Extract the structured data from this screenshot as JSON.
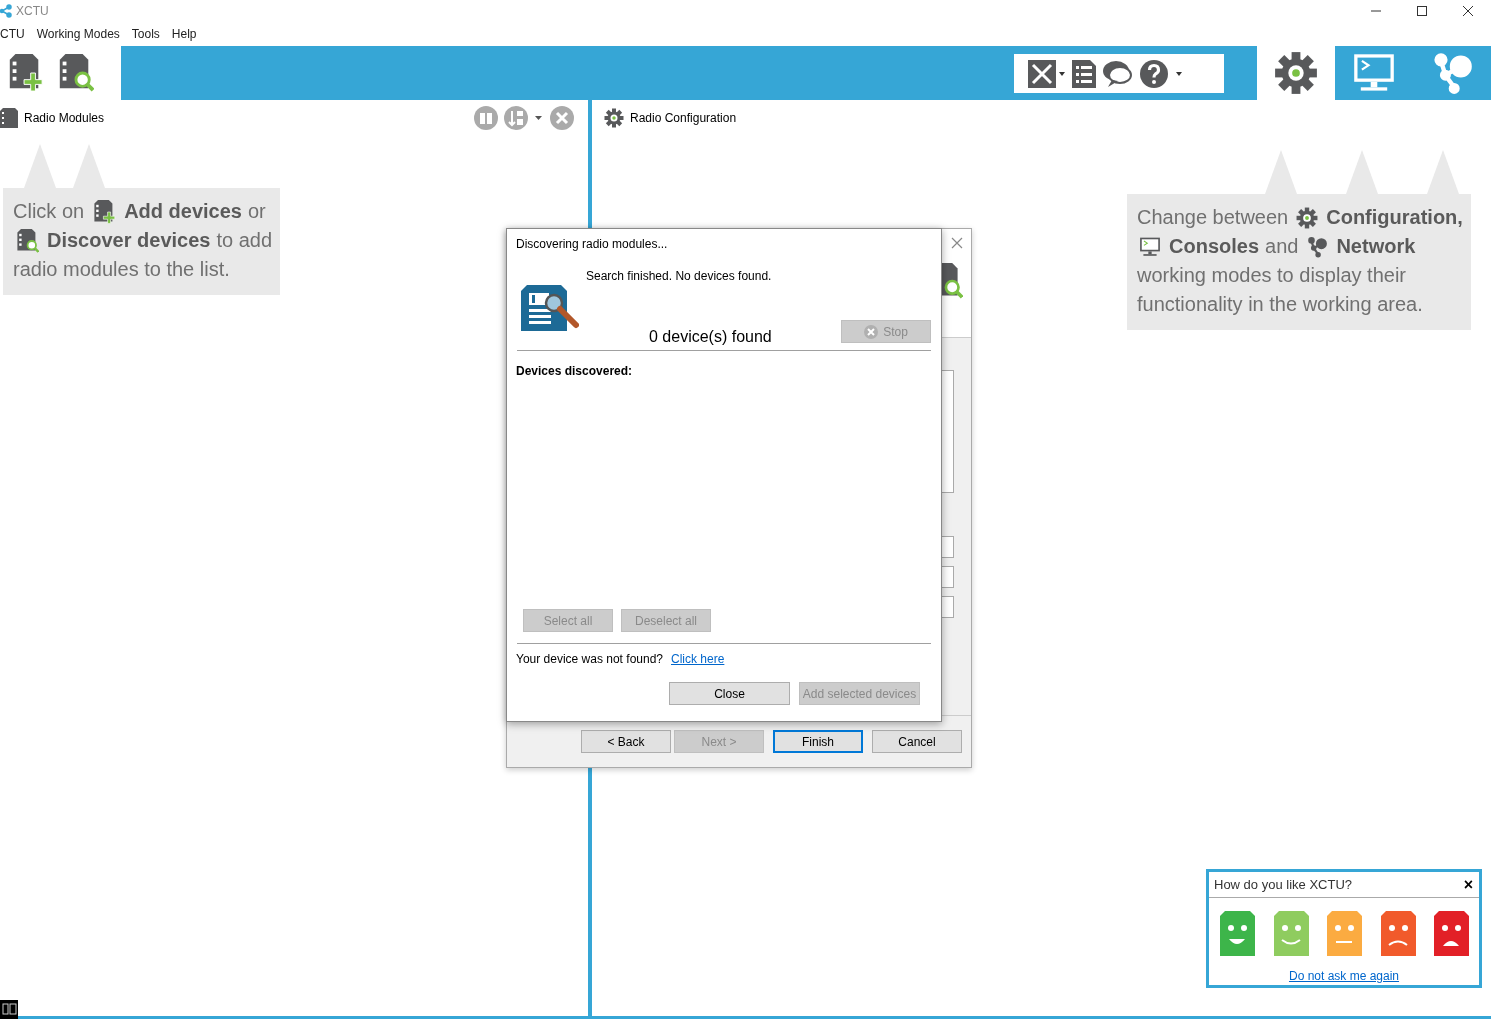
{
  "window": {
    "title": "XCTU"
  },
  "menu": [
    {
      "label": "CTU"
    },
    {
      "label": "Working Modes"
    },
    {
      "label": "Tools"
    },
    {
      "label": "Help"
    }
  ],
  "modes": [
    {
      "kind": "configuration",
      "selected": true
    },
    {
      "kind": "consoles",
      "selected": false
    },
    {
      "kind": "network",
      "selected": false
    }
  ],
  "left_panel": {
    "title": "Radio Modules",
    "hint": [
      [
        {
          "kind": "text",
          "text": "Click on"
        },
        {
          "kind": "icon"
        },
        {
          "kind": "bold",
          "text": "Add devices"
        },
        {
          "kind": "text",
          "text": "or"
        }
      ],
      [
        {
          "kind": "icon"
        },
        {
          "kind": "bold",
          "text": "Discover devices"
        },
        {
          "kind": "text",
          "text": "to add"
        }
      ],
      [
        {
          "kind": "text",
          "text": "radio modules to the list."
        }
      ]
    ]
  },
  "right_panel": {
    "title": "Radio Configuration",
    "hint": [
      [
        {
          "kind": "text",
          "text": "Change between"
        },
        {
          "kind": "icon"
        },
        {
          "kind": "bold",
          "text": "Configuration,"
        }
      ],
      [
        {
          "kind": "icon"
        },
        {
          "kind": "bold",
          "text": "Consoles"
        },
        {
          "kind": "text",
          "text": "and"
        },
        {
          "kind": "icon"
        },
        {
          "kind": "bold",
          "text": "Network"
        }
      ],
      [
        {
          "kind": "text",
          "text": "working modes to display their"
        }
      ],
      [
        {
          "kind": "text",
          "text": "functionality in the working area."
        }
      ]
    ]
  },
  "wizard": {
    "buttons": [
      {
        "label": "< Back",
        "disabled": false,
        "default": false
      },
      {
        "label": "Next >",
        "disabled": true,
        "default": false
      },
      {
        "label": "Finish",
        "disabled": false,
        "default": true
      },
      {
        "label": "Cancel",
        "disabled": false,
        "default": false
      }
    ]
  },
  "discovery_dialog": {
    "title": "Discovering radio modules...",
    "status": "Search finished. No devices found.",
    "count": "0 device(s) found",
    "stop": {
      "label": "Stop",
      "disabled": true
    },
    "list_label": "Devices discovered:",
    "list_buttons": [
      {
        "label": "Select all",
        "disabled": true
      },
      {
        "label": "Deselect all",
        "disabled": true
      }
    ],
    "not_found": "Your device was not found?",
    "link": "Click here",
    "buttons": [
      {
        "label": "Close",
        "disabled": false
      },
      {
        "label": "Add selected devices",
        "disabled": true
      }
    ]
  },
  "feedback": {
    "title": "How do you like XCTU?",
    "close": "×",
    "faces": [
      {
        "kind": "very-happy",
        "color": "#3db54a"
      },
      {
        "kind": "happy",
        "color": "#8fcc5f"
      },
      {
        "kind": "neutral",
        "color": "#fbab41"
      },
      {
        "kind": "sad",
        "color": "#f15a2b"
      },
      {
        "kind": "very-sad",
        "color": "#e22027"
      }
    ],
    "link": "Do not ask me again"
  }
}
